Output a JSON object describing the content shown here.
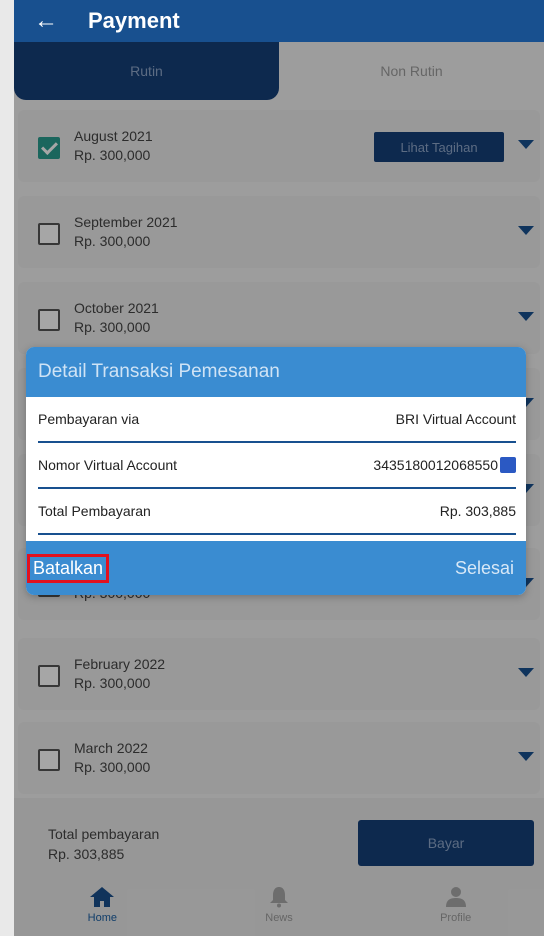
{
  "appbar": {
    "back_icon": "arrow-left-icon",
    "title": "Payment"
  },
  "tabs": [
    {
      "label": "Rutin",
      "active": true
    },
    {
      "label": "Non Rutin",
      "active": false
    }
  ],
  "months": [
    {
      "month": "August 2021",
      "amount": "Rp. 300,000",
      "checked": true,
      "action": "Lihat Tagihan"
    },
    {
      "month": "September 2021",
      "amount": "Rp. 300,000",
      "checked": false
    },
    {
      "month": "October 2021",
      "amount": "Rp. 300,000",
      "checked": false
    },
    {
      "month": "",
      "amount": "",
      "checked": false
    },
    {
      "month": "",
      "amount": "",
      "checked": false
    },
    {
      "month": "",
      "amount": "Rp. 300,000",
      "checked": false
    },
    {
      "month": "February 2022",
      "amount": "Rp. 300,000",
      "checked": false
    },
    {
      "month": "March 2022",
      "amount": "Rp. 300,000",
      "checked": false
    }
  ],
  "footer": {
    "total_label": "Total pembayaran",
    "total_value": "Rp. 303,885",
    "pay_label": "Bayar"
  },
  "nav": [
    {
      "label": "Home",
      "icon": "home-icon",
      "active": true
    },
    {
      "label": "News",
      "icon": "bell-icon",
      "active": false
    },
    {
      "label": "Profile",
      "icon": "person-icon",
      "active": false
    }
  ],
  "dialog": {
    "title": "Detail Transaksi Pemesanan",
    "rows": [
      {
        "label": "Pembayaran via",
        "value": "BRI Virtual Account"
      },
      {
        "label": "Nomor Virtual Account",
        "value": "3435180012068550"
      },
      {
        "label": "Total Pembayaran",
        "value": "Rp. 303,885"
      }
    ],
    "cancel_label": "Batalkan",
    "done_label": "Selesai"
  },
  "colors": {
    "primary": "#18508f",
    "dialog_header": "#3a8cd1",
    "highlight": "#e1111f"
  }
}
